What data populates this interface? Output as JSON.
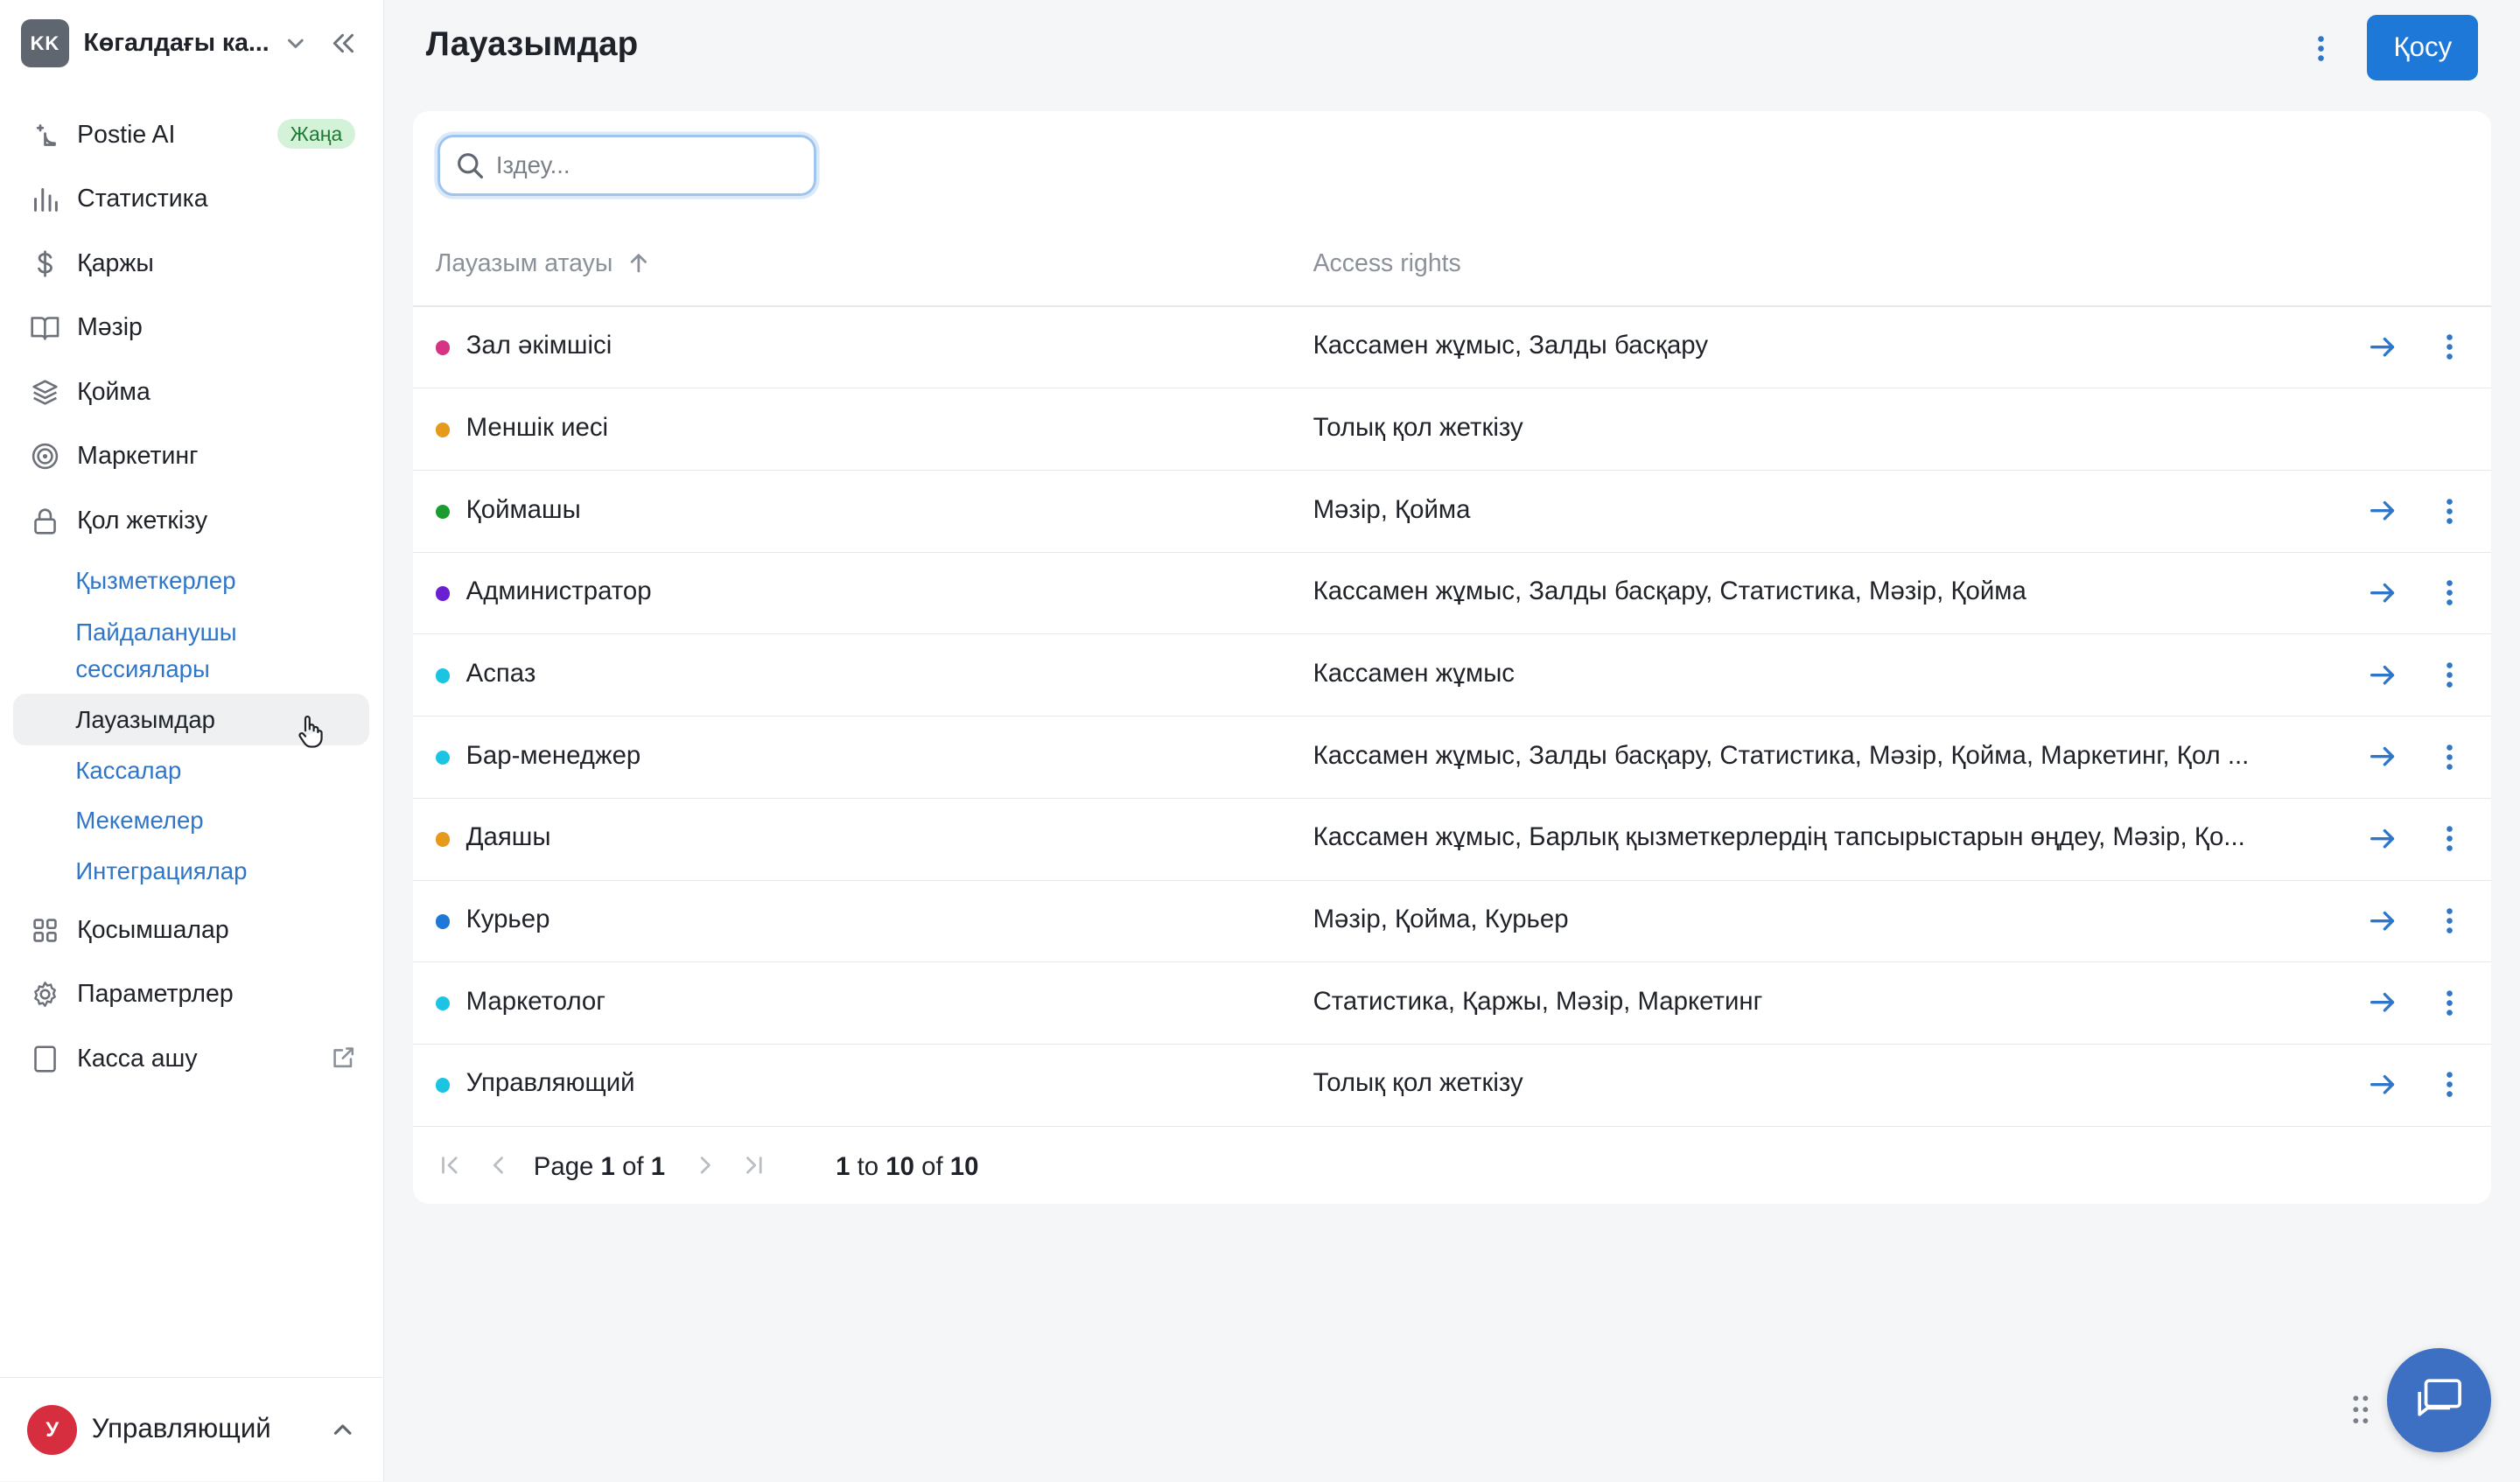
{
  "org": {
    "initials": "KK",
    "name": "Көгалдағы ка..."
  },
  "sidebar": {
    "items": [
      {
        "label": "Postie AI",
        "icon": "ai-sparkle-icon",
        "badge": "Жаңа"
      },
      {
        "label": "Статистика",
        "icon": "bar-chart-icon"
      },
      {
        "label": "Қаржы",
        "icon": "dollar-icon"
      },
      {
        "label": "Мәзір",
        "icon": "book-icon"
      },
      {
        "label": "Қойма",
        "icon": "layers-icon"
      },
      {
        "label": "Маркетинг",
        "icon": "target-icon"
      },
      {
        "label": "Қол жеткізу",
        "icon": "lock-icon"
      },
      {
        "label": "Қосымшалар",
        "icon": "grid-icon"
      },
      {
        "label": "Параметрлер",
        "icon": "gear-icon"
      },
      {
        "label": "Касса ашу",
        "icon": "tablet-icon"
      }
    ],
    "subitems": [
      {
        "label": "Қызметкерлер"
      },
      {
        "label": "Пайдаланушы сессиялары"
      },
      {
        "label": "Лауазымдар",
        "active": true
      },
      {
        "label": "Кассалар"
      },
      {
        "label": "Мекемелер"
      },
      {
        "label": "Интеграциялар"
      }
    ]
  },
  "user": {
    "initial": "У",
    "name": "Управляющий",
    "avatar_color": "#d62e3f"
  },
  "header": {
    "title": "Лауазымдар",
    "add_label": "Қосу"
  },
  "search": {
    "placeholder": "Іздеу..."
  },
  "table": {
    "columns": [
      "Лауазым атауы",
      "Access rights"
    ],
    "sort": "ascending",
    "rows": [
      {
        "name": "Зал әкімшісі",
        "color": "#d63384",
        "rights": "Кассамен жұмыс, Залды басқару",
        "actions": true
      },
      {
        "name": "Меншік иесі",
        "color": "#e59a1a",
        "rights": "Толық қол жеткізу",
        "actions": false
      },
      {
        "name": "Қоймашы",
        "color": "#1a9c2e",
        "rights": "Мәзір, Қойма",
        "actions": true
      },
      {
        "name": "Администратор",
        "color": "#6a1fd1",
        "rights": "Кассамен жұмыс, Залды басқару, Статистика, Мәзір, Қойма",
        "actions": true
      },
      {
        "name": "Аспаз",
        "color": "#1cc4e3",
        "rights": "Кассамен жұмыс",
        "actions": true
      },
      {
        "name": "Бар-менеджер",
        "color": "#1cc4e3",
        "rights": "Кассамен жұмыс, Залды басқару, Статистика, Мәзір, Қойма, Маркетинг, Қол ...",
        "actions": true
      },
      {
        "name": "Даяшы",
        "color": "#e59a1a",
        "rights": "Кассамен жұмыс, Барлық қызметкерлердің тапсырыстарын өңдеу, Мәзір, Қо...",
        "actions": true
      },
      {
        "name": "Курьер",
        "color": "#1e78d8",
        "rights": "Мәзір, Қойма, Курьер",
        "actions": true
      },
      {
        "name": "Маркетолог",
        "color": "#1cc4e3",
        "rights": "Статистика, Қаржы, Мәзір, Маркетинг",
        "actions": true
      },
      {
        "name": "Управляющий",
        "color": "#1cc4e3",
        "rights": "Толық қол жеткізу",
        "actions": true
      }
    ]
  },
  "pager": {
    "page_word": "Page",
    "current": "1",
    "of_word": "of",
    "total_pages": "1",
    "range_from": "1",
    "to_word": "to",
    "range_to": "10",
    "of_word2": "of",
    "total": "10"
  },
  "colors": {
    "accent": "#1e78d8",
    "link": "#2f76c8",
    "chat": "#3d6fc2"
  }
}
